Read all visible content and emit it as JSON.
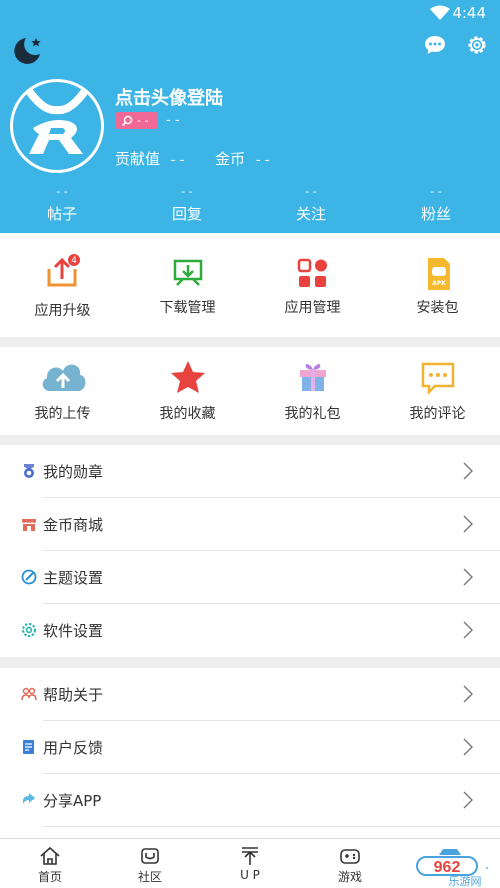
{
  "status": {
    "time": "4:44"
  },
  "profile": {
    "login_prompt": "点击头像登陆",
    "badge_value": "- -",
    "badge_suffix": "- -",
    "contrib_label": "贡献值",
    "contrib_value": "- -",
    "coins_label": "金币",
    "coins_value": "- -"
  },
  "stats": [
    {
      "value": "- -",
      "label": "帖子"
    },
    {
      "value": "- -",
      "label": "回复"
    },
    {
      "value": "- -",
      "label": "关注"
    },
    {
      "value": "- -",
      "label": "粉丝"
    }
  ],
  "grid1": [
    {
      "label": "应用升级",
      "icon": "upgrade-icon",
      "badge": "4"
    },
    {
      "label": "下载管理",
      "icon": "download-icon"
    },
    {
      "label": "应用管理",
      "icon": "apps-icon"
    },
    {
      "label": "安装包",
      "icon": "apk-icon"
    }
  ],
  "grid2": [
    {
      "label": "我的上传",
      "icon": "cloud-upload-icon"
    },
    {
      "label": "我的收藏",
      "icon": "star-icon"
    },
    {
      "label": "我的礼包",
      "icon": "gift-icon"
    },
    {
      "label": "我的评论",
      "icon": "comment-icon"
    }
  ],
  "list1": [
    {
      "label": "我的勋章",
      "icon": "medal-icon"
    },
    {
      "label": "金币商城",
      "icon": "shop-icon"
    },
    {
      "label": "主题设置",
      "icon": "theme-icon"
    },
    {
      "label": "软件设置",
      "icon": "settings-icon"
    }
  ],
  "list2": [
    {
      "label": "帮助关于",
      "icon": "help-icon"
    },
    {
      "label": "用户反馈",
      "icon": "feedback-icon"
    },
    {
      "label": "分享APP",
      "icon": "share-icon"
    }
  ],
  "nav": [
    {
      "label": "首页",
      "icon": "home-icon"
    },
    {
      "label": "社区",
      "icon": "community-icon"
    },
    {
      "label": "U P",
      "icon": "up-icon"
    },
    {
      "label": "游戏",
      "icon": "gamepad-icon"
    }
  ],
  "watermark": {
    "text": "962",
    "sub": "乐游网"
  },
  "colors": {
    "header": "#3db4e6",
    "accent_orange": "#f0922f",
    "accent_red": "#e8433e",
    "badge_pink": "#f06996"
  }
}
